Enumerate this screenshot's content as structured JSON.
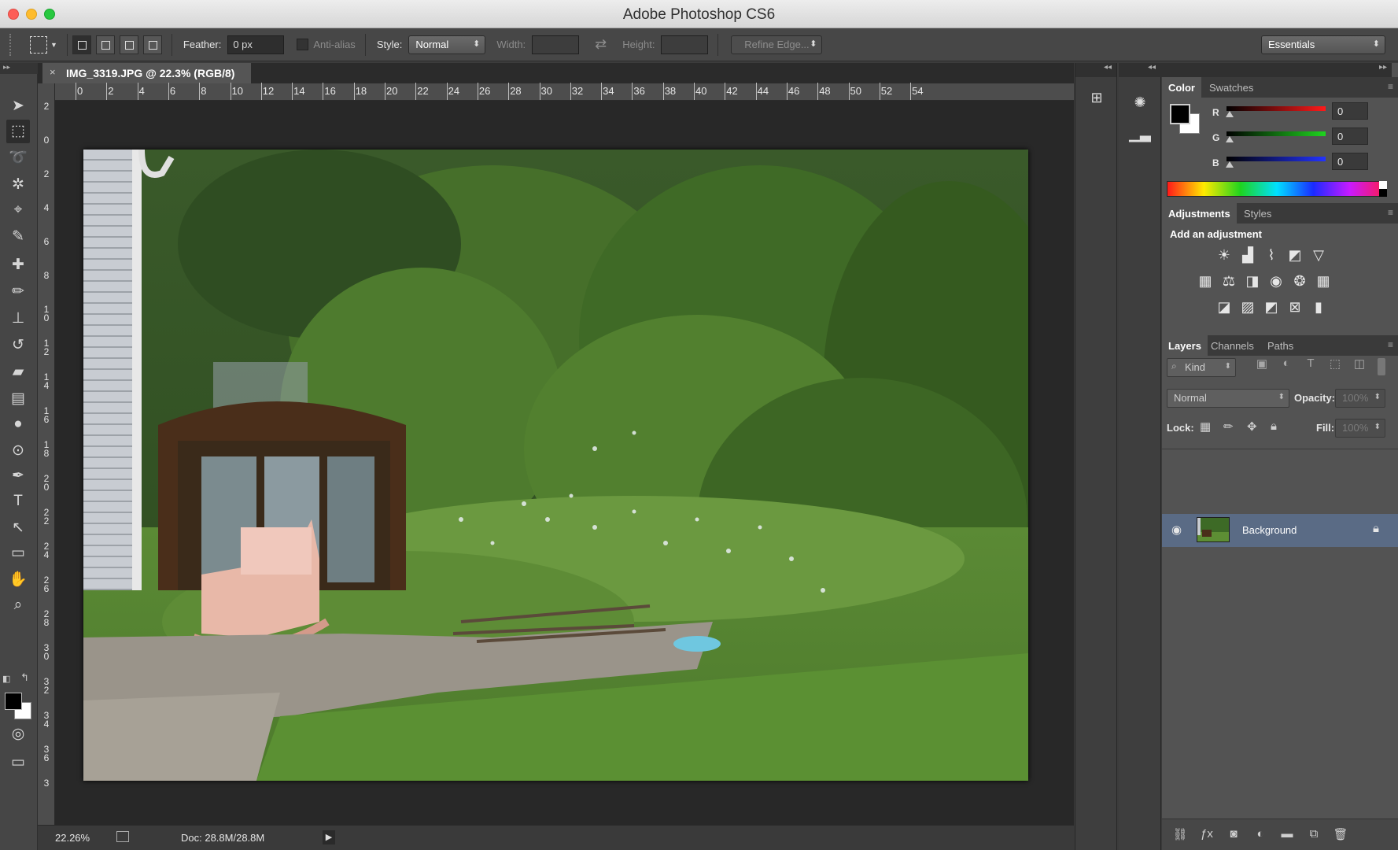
{
  "window": {
    "title": "Adobe Photoshop CS6"
  },
  "options_bar": {
    "feather_label": "Feather:",
    "feather_value": "0 px",
    "antialias_label": "Anti-alias",
    "style_label": "Style:",
    "style_value": "Normal",
    "width_label": "Width:",
    "height_label": "Height:",
    "refine_edge_label": "Refine Edge...",
    "workspace_value": "Essentials"
  },
  "document": {
    "tab_title": "IMG_3319.JPG @ 22.3% (RGB/8)",
    "close_glyph": "×"
  },
  "ruler": {
    "horizontal": [
      "0",
      "2",
      "4",
      "6",
      "8",
      "10",
      "12",
      "14",
      "16",
      "18",
      "20",
      "22",
      "24",
      "26",
      "28",
      "30",
      "32",
      "34",
      "36",
      "38",
      "40",
      "42",
      "44",
      "46",
      "48",
      "50",
      "52",
      "54"
    ],
    "vertical": [
      "2",
      "0",
      "2",
      "4",
      "6",
      "8",
      "1\n0",
      "1\n2",
      "1\n4",
      "1\n6",
      "1\n8",
      "2\n0",
      "2\n2",
      "2\n4",
      "2\n6",
      "2\n8",
      "3\n0",
      "3\n2",
      "3\n4",
      "3\n6",
      "3"
    ]
  },
  "status": {
    "zoom": "22.26%",
    "doc_size": "Doc: 28.8M/28.8M"
  },
  "tools": [
    {
      "name": "move-tool",
      "glyph": "➤"
    },
    {
      "name": "marquee-tool",
      "glyph": "⬚"
    },
    {
      "name": "lasso-tool",
      "glyph": "➰"
    },
    {
      "name": "magic-wand-tool",
      "glyph": "✲"
    },
    {
      "name": "crop-tool",
      "glyph": "⌖"
    },
    {
      "name": "eyedropper-tool",
      "glyph": "✎"
    },
    {
      "name": "healing-brush-tool",
      "glyph": "✚"
    },
    {
      "name": "brush-tool",
      "glyph": "✏"
    },
    {
      "name": "clone-stamp-tool",
      "glyph": "⊥"
    },
    {
      "name": "history-brush-tool",
      "glyph": "↺"
    },
    {
      "name": "eraser-tool",
      "glyph": "▰"
    },
    {
      "name": "gradient-tool",
      "glyph": "▤"
    },
    {
      "name": "blur-tool",
      "glyph": "●"
    },
    {
      "name": "dodge-tool",
      "glyph": "⊙"
    },
    {
      "name": "pen-tool",
      "glyph": "✒"
    },
    {
      "name": "type-tool",
      "glyph": "T"
    },
    {
      "name": "path-selection-tool",
      "glyph": "↖"
    },
    {
      "name": "rectangle-tool",
      "glyph": "▭"
    },
    {
      "name": "hand-tool",
      "glyph": "✋"
    },
    {
      "name": "zoom-tool",
      "glyph": "⌕"
    }
  ],
  "color_panel": {
    "tabs": [
      "Color",
      "Swatches"
    ],
    "r_label": "R",
    "g_label": "G",
    "b_label": "B",
    "r_value": "0",
    "g_value": "0",
    "b_value": "0",
    "foreground": "#000000",
    "background": "#ffffff"
  },
  "adjustments_panel": {
    "tabs": [
      "Adjustments",
      "Styles"
    ],
    "heading": "Add an adjustment",
    "icons": [
      "brightness-contrast-icon",
      "levels-icon",
      "curves-icon",
      "exposure-icon",
      "vibrance-icon",
      "hue-saturation-icon",
      "color-balance-icon",
      "black-white-icon",
      "photo-filter-icon",
      "channel-mixer-icon",
      "color-lookup-icon",
      "invert-icon",
      "posterize-icon",
      "threshold-icon",
      "selective-color-icon",
      "gradient-map-icon"
    ]
  },
  "layers_panel": {
    "tabs": [
      "Layers",
      "Channels",
      "Paths"
    ],
    "kind_filter": "Kind",
    "blend_mode": "Normal",
    "opacity_label": "Opacity:",
    "opacity_value": "100%",
    "lock_label": "Lock:",
    "fill_label": "Fill:",
    "fill_value": "100%",
    "layers": [
      {
        "name": "Background",
        "visible": true,
        "locked": true
      }
    ]
  },
  "panel_menu_glyph": "≡",
  "collapse_glyph": "◂◂",
  "expand_glyph": "▸▸",
  "accent": "#5a6b85"
}
